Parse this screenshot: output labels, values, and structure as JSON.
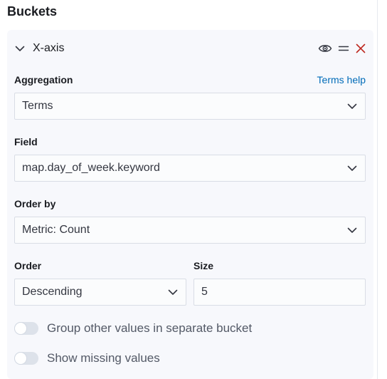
{
  "section": {
    "title": "Buckets"
  },
  "aggregation_header": {
    "title": "X-axis",
    "icons": [
      "chevron-down-icon",
      "eye-icon",
      "drag-handle-icon",
      "close-icon"
    ],
    "close_color": "#bd271e"
  },
  "form": {
    "aggregation": {
      "label": "Aggregation",
      "help_link": "Terms help",
      "value": "Terms"
    },
    "field": {
      "label": "Field",
      "value": "map.day_of_week.keyword"
    },
    "order_by": {
      "label": "Order by",
      "value": "Metric: Count"
    },
    "order": {
      "label": "Order",
      "value": "Descending"
    },
    "size": {
      "label": "Size",
      "value": "5"
    }
  },
  "switches": [
    {
      "label": "Group other values in separate bucket",
      "checked": false
    },
    {
      "label": "Show missing values",
      "checked": false
    }
  ],
  "colors": {
    "link": "#006bb8",
    "panel_bg": "#f7f8fc",
    "input_border": "#d9dde5"
  }
}
